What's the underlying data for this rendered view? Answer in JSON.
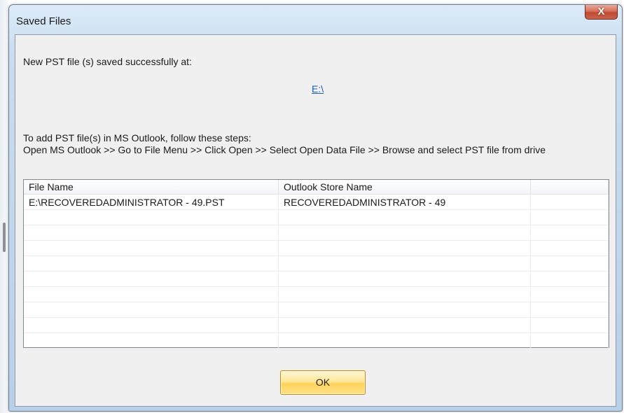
{
  "window": {
    "title": "Saved Files",
    "close_label": "X"
  },
  "message": {
    "saved_text": "New PST file (s) saved successfully at:",
    "path_link": "E:\\",
    "steps_intro": "To add PST file(s) in MS Outlook, follow these steps:",
    "steps_detail": "Open MS Outlook  >> Go to File Menu >> Click Open >> Select Open Data File >>  Browse and select PST file from drive"
  },
  "table": {
    "headers": [
      "File Name",
      "Outlook Store Name",
      ""
    ],
    "rows": [
      [
        "E:\\RECOVEREDADMINISTRATOR - 49.PST",
        "RECOVEREDADMINISTRATOR - 49",
        ""
      ]
    ]
  },
  "footer": {
    "ok_label": "OK"
  },
  "colors": {
    "link": "#1b5fb8",
    "ok_button": "#ffd35a",
    "close_button": "#c14a32"
  }
}
